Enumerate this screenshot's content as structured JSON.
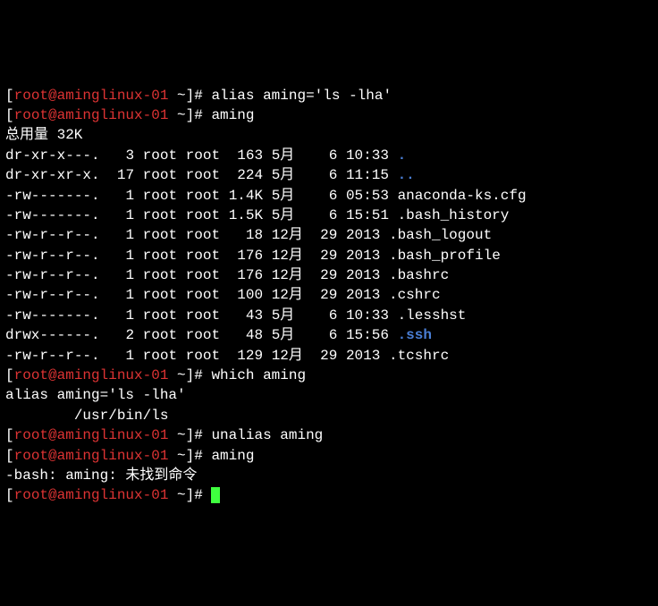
{
  "prompt": {
    "open": "[",
    "user": "root",
    "at": "@",
    "host": "aminglinux-01",
    "path": " ~",
    "close": "]# "
  },
  "cmd1": "alias aming='ls -lha'",
  "cmd2": "aming",
  "total": "总用量 32K",
  "rows": [
    {
      "perm": "dr-xr-x---.",
      "links": "  3",
      "owner": "root",
      "group": "root",
      "size": " 163",
      "mon": "5月",
      "day": "   6",
      "time": "10:33",
      "name": ".",
      "color": "dir"
    },
    {
      "perm": "dr-xr-xr-x.",
      "links": " 17",
      "owner": "root",
      "group": "root",
      "size": " 224",
      "mon": "5月",
      "day": "   6",
      "time": "11:15",
      "name": "..",
      "color": "dir"
    },
    {
      "perm": "-rw-------.",
      "links": "  1",
      "owner": "root",
      "group": "root",
      "size": "1.4K",
      "mon": "5月",
      "day": "   6",
      "time": "05:53",
      "name": "anaconda-ks.cfg",
      "color": ""
    },
    {
      "perm": "-rw-------.",
      "links": "  1",
      "owner": "root",
      "group": "root",
      "size": "1.5K",
      "mon": "5月",
      "day": "   6",
      "time": "15:51",
      "name": ".bash_history",
      "color": ""
    },
    {
      "perm": "-rw-r--r--.",
      "links": "  1",
      "owner": "root",
      "group": "root",
      "size": "  18",
      "mon": "12月",
      "day": " 29",
      "time": "2013",
      "name": ".bash_logout",
      "color": ""
    },
    {
      "perm": "-rw-r--r--.",
      "links": "  1",
      "owner": "root",
      "group": "root",
      "size": " 176",
      "mon": "12月",
      "day": " 29",
      "time": "2013",
      "name": ".bash_profile",
      "color": ""
    },
    {
      "perm": "-rw-r--r--.",
      "links": "  1",
      "owner": "root",
      "group": "root",
      "size": " 176",
      "mon": "12月",
      "day": " 29",
      "time": "2013",
      "name": ".bashrc",
      "color": ""
    },
    {
      "perm": "-rw-r--r--.",
      "links": "  1",
      "owner": "root",
      "group": "root",
      "size": " 100",
      "mon": "12月",
      "day": " 29",
      "time": "2013",
      "name": ".cshrc",
      "color": ""
    },
    {
      "perm": "-rw-------.",
      "links": "  1",
      "owner": "root",
      "group": "root",
      "size": "  43",
      "mon": "5月",
      "day": "   6",
      "time": "10:33",
      "name": ".lesshst",
      "color": ""
    },
    {
      "perm": "drwx------.",
      "links": "  2",
      "owner": "root",
      "group": "root",
      "size": "  48",
      "mon": "5月",
      "day": "   6",
      "time": "15:56",
      "name": ".ssh",
      "color": "dir"
    },
    {
      "perm": "-rw-r--r--.",
      "links": "  1",
      "owner": "root",
      "group": "root",
      "size": " 129",
      "mon": "12月",
      "day": " 29",
      "time": "2013",
      "name": ".tcshrc",
      "color": ""
    }
  ],
  "cmd3": "which aming",
  "which_out1": "alias aming='ls -lha'",
  "which_out2": "        /usr/bin/ls",
  "cmd4": "unalias aming",
  "cmd5": "aming",
  "err": "-bash: aming: 未找到命令"
}
